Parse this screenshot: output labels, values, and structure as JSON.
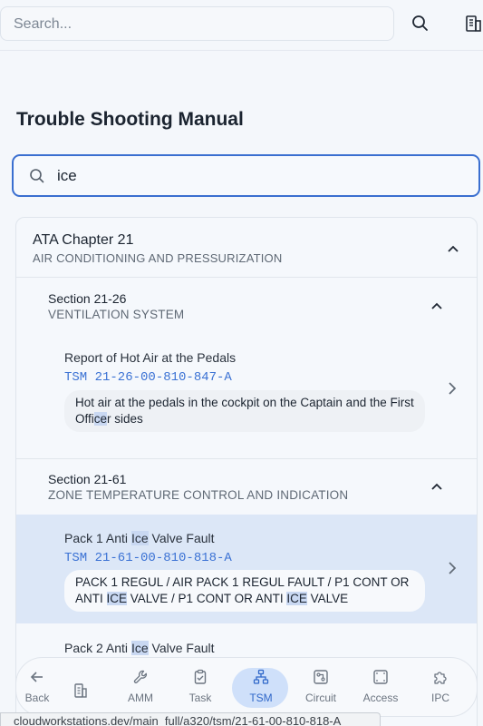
{
  "search": {
    "placeholder": "Search..."
  },
  "page": {
    "title": "Trouble Shooting Manual"
  },
  "filter": {
    "value": "ice"
  },
  "chapter": {
    "title": "ATA Chapter 21",
    "subtitle": "AIR CONDITIONING AND PRESSURIZATION"
  },
  "sections": [
    {
      "title": "Section 21-26",
      "subtitle": "VENTILATION SYSTEM",
      "items": [
        {
          "title": "Report of Hot Air at the Pedals",
          "code": "TSM 21-26-00-810-847-A",
          "desc_pre": "Hot air at the pedals in the cockpit on the Captain and the First Offi",
          "desc_hl": "ce",
          "desc_post": "r sides"
        }
      ]
    },
    {
      "title": "Section 21-61",
      "subtitle": "ZONE TEMPERATURE CONTROL AND INDICATION",
      "items": [
        {
          "title_pre": "Pack 1 Anti ",
          "title_hl": "Ice",
          "title_post": " Valve Fault",
          "code": "TSM 21-61-00-810-818-A",
          "desc_a": "PACK 1 REGUL / AIR PACK 1 REGUL FAULT / P1 CONT OR ANTI ",
          "desc_hl1": "ICE",
          "desc_b": " VALVE / P1 CONT OR ANTI ",
          "desc_hl2": "ICE",
          "desc_c": " VALVE"
        },
        {
          "title_pre": "Pack 2 Anti ",
          "title_hl": "Ice",
          "title_post": " Valve Fault"
        }
      ]
    }
  ],
  "nav": [
    {
      "label": "Back",
      "icon": "arrow-left-icon"
    },
    {
      "label": "",
      "icon": "building-icon"
    },
    {
      "label": "AMM",
      "icon": "wrench-icon"
    },
    {
      "label": "Task",
      "icon": "clipboard-check-icon"
    },
    {
      "label": "TSM",
      "icon": "network-icon"
    },
    {
      "label": "Circuit",
      "icon": "circuit-icon"
    },
    {
      "label": "Access",
      "icon": "access-panel-icon"
    },
    {
      "label": "IPC",
      "icon": "puzzle-icon"
    }
  ],
  "status_url": "cloudworkstations.dev/main_full/a320/tsm/21-61-00-810-818-A",
  "colors": {
    "accent": "#3a6fd0",
    "highlight": "#c9d8f2",
    "active_row": "#dce7f7"
  }
}
